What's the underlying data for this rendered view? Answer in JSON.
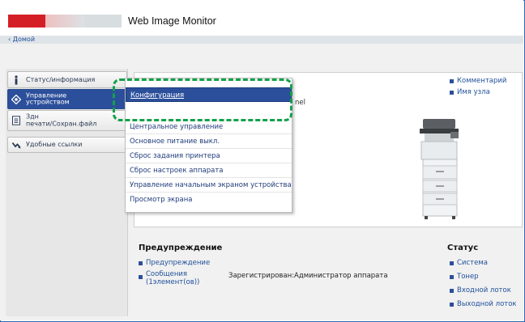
{
  "window": {
    "app_title": "Web Image Monitor",
    "home_link": "‹ Домой"
  },
  "sidebar": {
    "items": [
      {
        "label": "Статус/информация",
        "icon": "info-icon"
      },
      {
        "label": "Управление\nустройством",
        "icon": "device-management-icon"
      },
      {
        "label": "Здн\nпечати/Сохран.файл",
        "icon": "print-job-icon"
      },
      {
        "label": "Удобные ссылки",
        "icon": "link-icon"
      }
    ]
  },
  "dropdown": {
    "items": [
      "Конфигурация",
      "Центральное управление",
      "Основное питание выкл.",
      "Сброс задания принтера",
      "Сброс настроек аппарата",
      "Управление начальным экраном устройства",
      "Просмотр экрана"
    ],
    "selected_index": 0
  },
  "content": {
    "right_links": [
      "Комментарий",
      "Имя узла"
    ],
    "partial_text": "nel"
  },
  "warning": {
    "title": "Предупреждение",
    "links": [
      "Предупреждение"
    ],
    "messages_label": "Сообщения\n(1элемент(ов))",
    "registered_text": "Зарегистрирован:Администратор аппарата"
  },
  "status": {
    "title": "Статус",
    "links": [
      "Система",
      "Тонер",
      "Входной лоток",
      "Выходной лоток"
    ]
  },
  "colors": {
    "accent": "#2c4f9b",
    "highlight": "#13a14a",
    "brand": "#d51f26"
  }
}
